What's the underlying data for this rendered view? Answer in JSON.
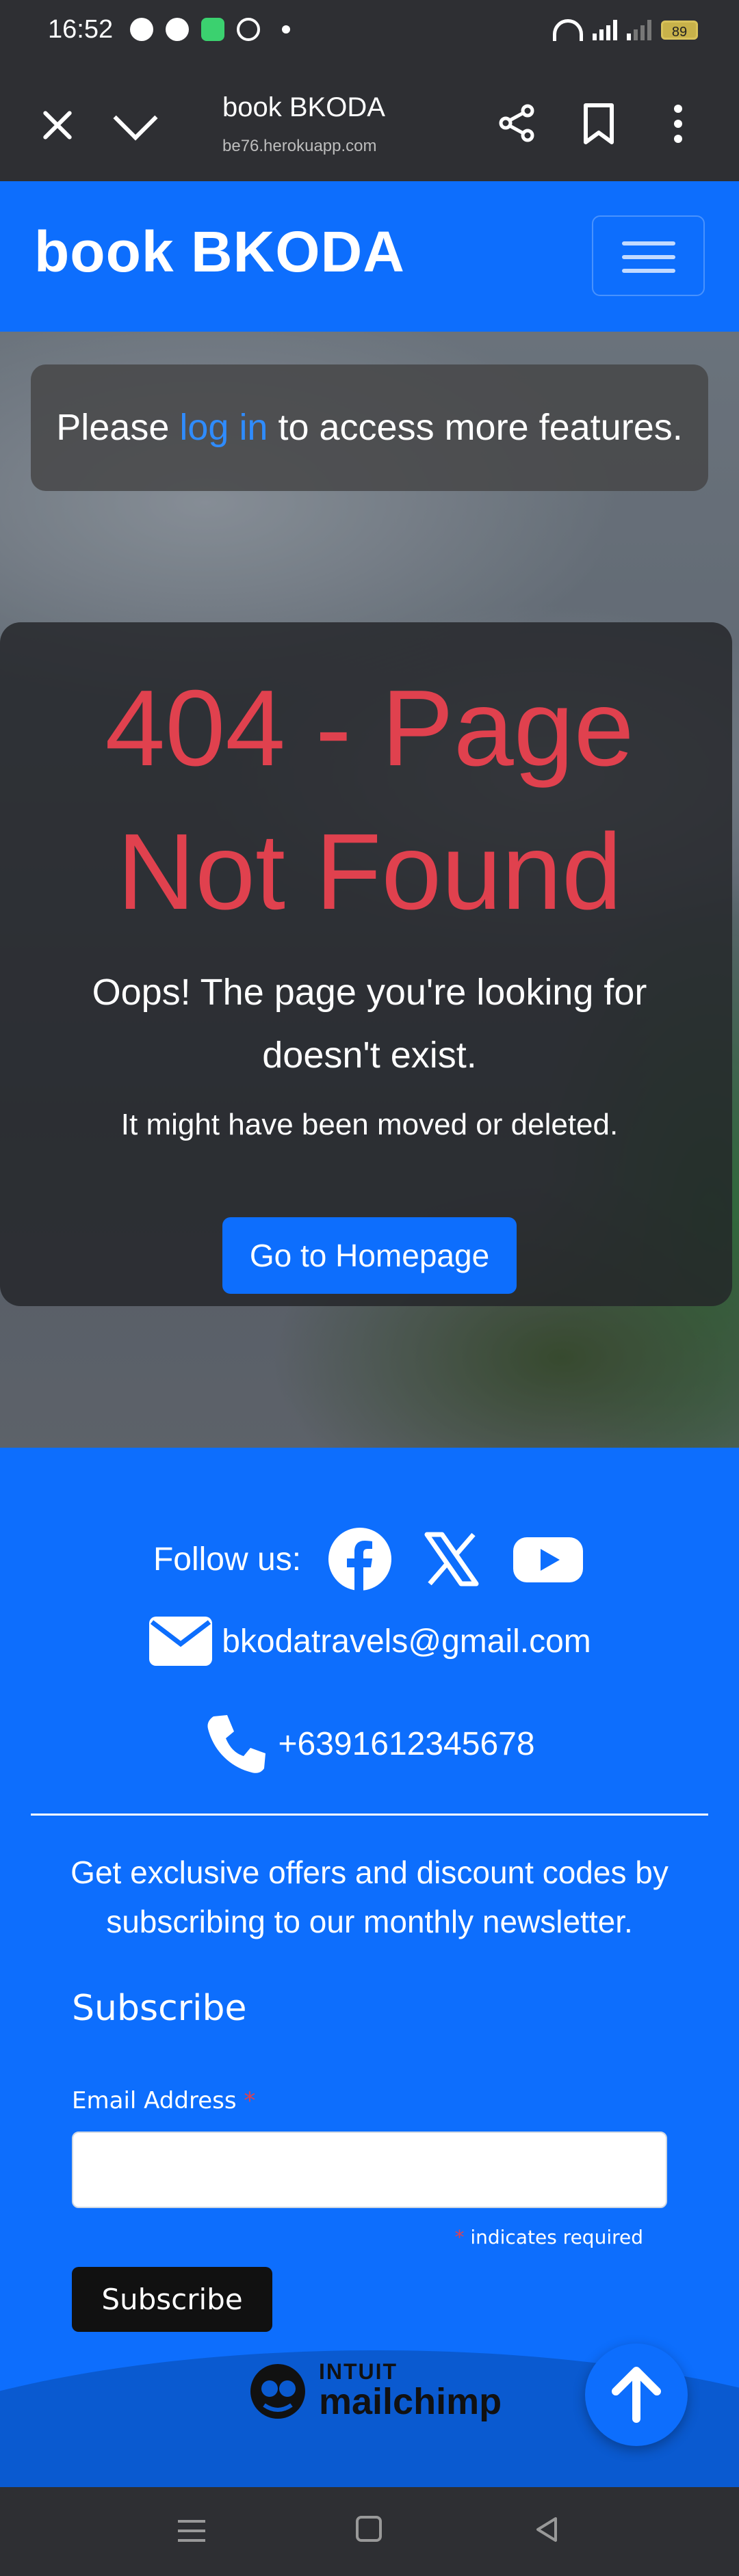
{
  "status_bar": {
    "time": "16:52",
    "battery": "89",
    "icons_left": [
      "facebook-icon",
      "messenger-icon",
      "message-icon",
      "google-icon",
      "dot-icon"
    ],
    "icons_right": [
      "wifi-icon",
      "signal-icon",
      "signal-icon",
      "battery-icon"
    ]
  },
  "browser": {
    "page_title": "book BKODA",
    "url": "be76.herokuapp.com",
    "icons": [
      "close-icon",
      "chevron-down-icon",
      "share-icon",
      "bookmark-icon",
      "more-icon"
    ]
  },
  "navbar": {
    "brand": "book BKODA",
    "toggler_icon": "hamburger-icon"
  },
  "alert": {
    "prefix": "Please ",
    "link": "log in",
    "suffix": " to access more features."
  },
  "error": {
    "title": "404 - Page Not Found",
    "message": "Oops! The page you're looking for doesn't exist.",
    "sub": "It might have been moved or deleted.",
    "button": "Go to Homepage"
  },
  "footer": {
    "follow_label": "Follow us:",
    "socials": [
      "facebook-icon",
      "x-icon",
      "youtube-icon"
    ],
    "email": "bkodatravels@gmail.com",
    "phone": "+6391612345678",
    "newsletter_text": "Get exclusive offers and discount codes by subscribing to our monthly newsletter.",
    "subscribe_heading": "Subscribe",
    "email_label": "Email Address ",
    "required_star": "*",
    "required_note": " indicates required",
    "email_value": "",
    "subscribe_button": "Subscribe",
    "mailchimp_line1": "INTUIT",
    "mailchimp_line2": "mailchimp"
  },
  "colors": {
    "brand_blue": "#0d6efd",
    "error_red": "#e0414e",
    "status_bg": "#2e2f33"
  }
}
